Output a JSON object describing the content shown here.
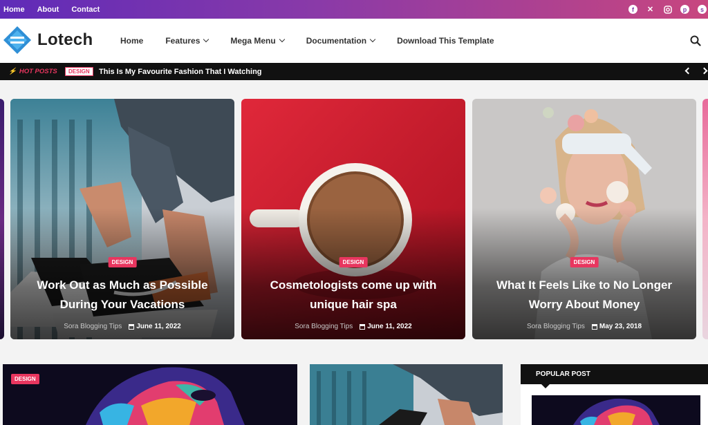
{
  "topbar": {
    "links": [
      "Home",
      "About",
      "Contact"
    ],
    "social_icons": [
      "facebook-icon",
      "x-icon",
      "instagram-icon",
      "pinterest-icon",
      "skype-icon"
    ]
  },
  "header": {
    "logo_text": "Lotech",
    "nav": [
      {
        "label": "Home",
        "dropdown": false
      },
      {
        "label": "Features",
        "dropdown": true
      },
      {
        "label": "Mega Menu",
        "dropdown": true
      },
      {
        "label": "Documentation",
        "dropdown": true
      },
      {
        "label": "Download This Template",
        "dropdown": false
      }
    ]
  },
  "ticker": {
    "label": "HOT POSTS",
    "tag": "DESIGN",
    "title": "This Is My Favourite Fashion That I Watching"
  },
  "cards": [
    {
      "category": "DESIGN",
      "title": "Work Out as Much as Possible During Your Vacations",
      "author": "Sora Blogging Tips",
      "date": "June 11, 2022"
    },
    {
      "category": "DESIGN",
      "title": "Cosmetologists come up with unique hair spa",
      "author": "Sora Blogging Tips",
      "date": "June 11, 2022"
    },
    {
      "category": "DESIGN",
      "title": "What It Feels Like to No Longer Worry About Money",
      "author": "Sora Blogging Tips",
      "date": "May 23, 2018"
    }
  ],
  "lower": {
    "card1_category": "DESIGN"
  },
  "popular": {
    "heading": "POPULAR POST"
  },
  "colors": {
    "accent": "#e8365f",
    "topbar_start": "#5f2bb8",
    "topbar_end": "#c8467f",
    "ticker_bg": "#111111"
  }
}
